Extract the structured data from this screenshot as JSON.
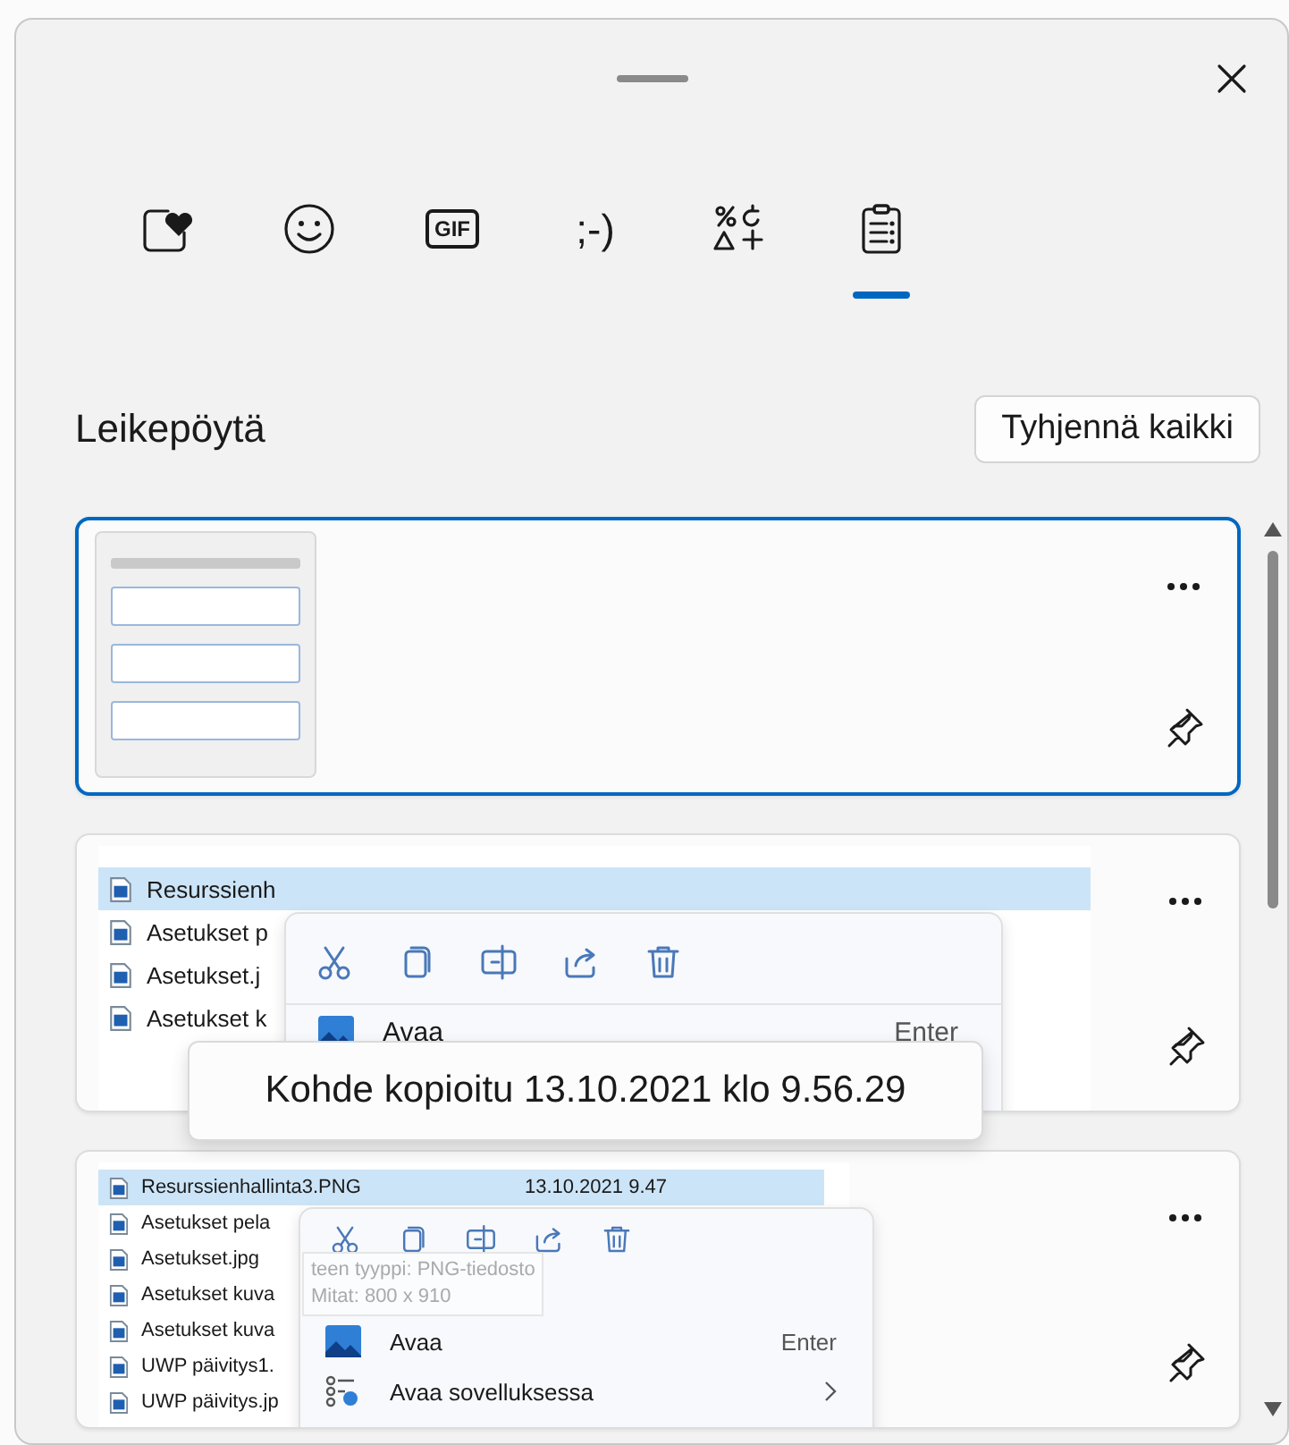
{
  "tabs": [
    {
      "kind": "favorites",
      "selected": false
    },
    {
      "kind": "emoji",
      "selected": false
    },
    {
      "kind": "gif",
      "label": "GIF",
      "selected": false
    },
    {
      "kind": "kaomoji",
      "label": ";-)",
      "selected": false
    },
    {
      "kind": "symbols",
      "selected": false
    },
    {
      "kind": "clipboard",
      "selected": true
    }
  ],
  "header": {
    "title": "Leikepöytä",
    "clear_button": "Tyhjennä kaikki"
  },
  "items": [
    {
      "kind": "thumbnail",
      "selected": true,
      "pinned": false
    },
    {
      "kind": "explorer",
      "selected": false,
      "pinned": false,
      "rows": [
        {
          "name": "Resurssienh",
          "selected": true
        },
        {
          "name": "Asetukset p",
          "selected": false
        },
        {
          "name": "Asetukset.j",
          "selected": false
        },
        {
          "name": "Asetukset k",
          "selected": false
        }
      ],
      "menu": {
        "actions": [
          {
            "kind": "cut"
          },
          {
            "kind": "copy"
          },
          {
            "kind": "rename"
          },
          {
            "kind": "share"
          },
          {
            "kind": "delete"
          }
        ],
        "entries": [
          {
            "label": "Avaa",
            "shortcut": "Enter",
            "kind": "open"
          }
        ]
      }
    },
    {
      "kind": "explorer_compact",
      "selected": false,
      "pinned": false,
      "rows": [
        {
          "name": "Resurssienhallinta3.PNG",
          "date": "13.10.2021 9.47",
          "selected": true
        },
        {
          "name": "Asetukset pela",
          "selected": false
        },
        {
          "name": "Asetukset.jpg",
          "selected": false
        },
        {
          "name": "Asetukset kuva",
          "selected": false
        },
        {
          "name": "Asetukset kuva",
          "selected": false
        },
        {
          "name": "UWP päivitys1.",
          "selected": false
        },
        {
          "name": "UWP päivitys.jp",
          "selected": false
        }
      ],
      "hover_tip": [
        "teen tyyppi: PNG-tiedosto",
        "Mitat: 800 x 910"
      ],
      "menu": {
        "actions": [
          {
            "kind": "cut"
          },
          {
            "kind": "copy"
          },
          {
            "kind": "rename"
          },
          {
            "kind": "share"
          },
          {
            "kind": "delete"
          }
        ],
        "entries": [
          {
            "label": "Avaa",
            "shortcut": "Enter",
            "kind": "open"
          },
          {
            "label": "Avaa sovelluksessa",
            "kind": "submenu"
          }
        ]
      }
    }
  ],
  "tooltip": "Kohde kopioitu 13.10.2021 klo 9.56.29"
}
